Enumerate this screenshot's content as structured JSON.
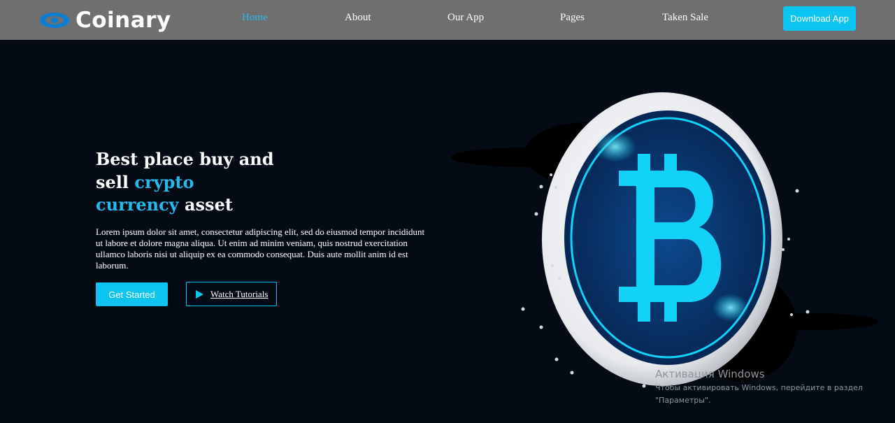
{
  "brand": {
    "name": "Coinary",
    "icon": "eye-logo-icon"
  },
  "nav": {
    "items": [
      {
        "label": "Home",
        "active": true
      },
      {
        "label": "About",
        "active": false
      },
      {
        "label": "Our App",
        "active": false
      },
      {
        "label": "Pages",
        "active": false
      },
      {
        "label": "Taken Sale",
        "active": false
      }
    ],
    "download_label": "Download App"
  },
  "hero": {
    "headline": {
      "line1": "Best place buy and",
      "line2_prefix": "sell ",
      "line2_accent": "crypto",
      "line3_accent": "currency",
      "line3_suffix": " asset"
    },
    "description": "Lorem ipsum dolor sit amet, consectetur adipiscing elit, sed do eiusmod tempor incididunt ut labore et dolore magna aliqua. Ut enim ad minim veniam, quis nostrud exercitation ullamco laboris nisi ut aliquip ex ea commodo consequat. Duis aute mollit anim id est laborum.",
    "primary_button": "Get Started",
    "secondary_button": "Watch Tutorials",
    "secondary_icon": "play-icon",
    "illustration_icon": "bitcoin-coin-icon"
  },
  "watermark": {
    "title": "Активация Windows",
    "line1": "Чтобы активировать Windows, перейдите в раздел",
    "line2": "\"Параметры\"."
  },
  "colors": {
    "accent": "#0bc4f0",
    "header_bg": "#6f6f6f",
    "page_bg": "#050b14",
    "coin_blue": "#0a3a7a",
    "bitcoin_cyan": "#12d2f7"
  }
}
